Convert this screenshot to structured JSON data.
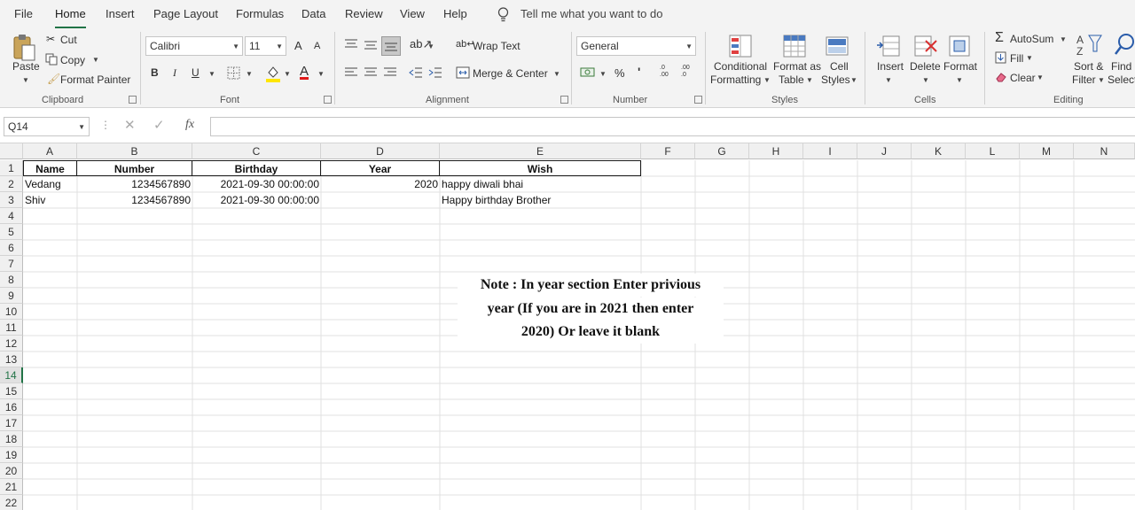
{
  "menu": {
    "tabs": [
      "File",
      "Home",
      "Insert",
      "Page Layout",
      "Formulas",
      "Data",
      "Review",
      "View",
      "Help"
    ],
    "tell_me": "Tell me what you want to do"
  },
  "ribbon": {
    "clipboard": {
      "paste": "Paste",
      "cut": "Cut",
      "copy": "Copy",
      "format_painter": "Format Painter",
      "label": "Clipboard"
    },
    "font": {
      "name": "Calibri",
      "size": "11",
      "bold": "B",
      "italic": "I",
      "underline": "U",
      "grow": "A",
      "shrink": "A",
      "font_color": "A",
      "label": "Font"
    },
    "alignment": {
      "wrap_text": "Wrap Text",
      "merge_center": "Merge & Center",
      "label": "Alignment"
    },
    "number": {
      "format": "General",
      "percent": "%",
      "comma": "'",
      "inc_decimal": ".0 .00",
      "dec_decimal": ".00 .0",
      "label": "Number"
    },
    "styles": {
      "conditional": "Conditional",
      "formatting": "Formatting",
      "format_as": "Format as",
      "table": "Table",
      "cell": "Cell",
      "cell_styles": "Styles",
      "label": "Styles"
    },
    "cells": {
      "insert": "Insert",
      "delete": "Delete",
      "format": "Format",
      "label": "Cells"
    },
    "editing": {
      "autosum": "AutoSum",
      "fill": "Fill",
      "clear": "Clear",
      "sort": "Sort &",
      "filter": "Filter",
      "find": "Find &",
      "select": "Select",
      "label": "Editing"
    }
  },
  "formula_bar": {
    "name_box": "Q14",
    "fx": "fx",
    "value": ""
  },
  "sheet": {
    "columns": [
      "A",
      "B",
      "C",
      "D",
      "E",
      "F",
      "G",
      "H",
      "I",
      "J",
      "K",
      "L",
      "M",
      "N"
    ],
    "rows": [
      "1",
      "2",
      "3",
      "4",
      "5",
      "6",
      "7",
      "8",
      "9",
      "10",
      "11",
      "12",
      "13",
      "14",
      "15",
      "16",
      "17",
      "18",
      "19",
      "20",
      "21",
      "22"
    ],
    "selected_row": "14",
    "headers": {
      "name": "Name",
      "number": "Number",
      "birthday": "Birthday",
      "year": "Year",
      "wish": "Wish"
    },
    "data": [
      {
        "name": "Vedang",
        "number": "1234567890",
        "birthday": "2021-09-30 00:00:00",
        "year": "2020",
        "wish": "happy diwali bhai"
      },
      {
        "name": "Shiv",
        "number": "1234567890",
        "birthday": "2021-09-30 00:00:00",
        "year": "",
        "wish": "Happy birthday Brother"
      }
    ],
    "note": {
      "line1": "Note : In year section Enter privious",
      "line2": "year (If you are  in 2021 then enter",
      "line3": "2020) Or leave it blank"
    }
  }
}
